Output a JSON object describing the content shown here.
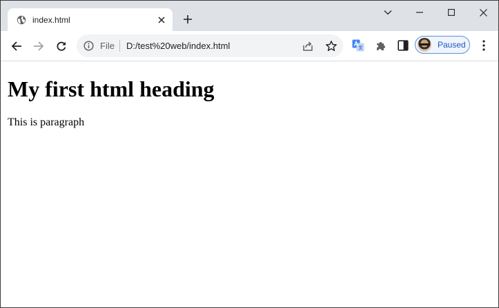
{
  "tab": {
    "title": "index.html",
    "favicon": "globe-icon"
  },
  "window_controls": [
    "tab-search",
    "minimize",
    "maximize",
    "close"
  ],
  "toolbar": {
    "back": "back-arrow-icon",
    "forward": "forward-arrow-icon",
    "reload": "reload-icon"
  },
  "omnibox": {
    "scheme_label": "File",
    "url": "D:/test%20web/index.html"
  },
  "profile": {
    "status_label": "Paused"
  },
  "page": {
    "heading": "My first html heading",
    "paragraph": "This is paragraph"
  },
  "colors": {
    "tabstrip_bg": "#dee1e6",
    "omnibox_bg": "#f1f3f4",
    "profile_accent": "#1a56c4",
    "translate_blue": "#4285f4"
  }
}
